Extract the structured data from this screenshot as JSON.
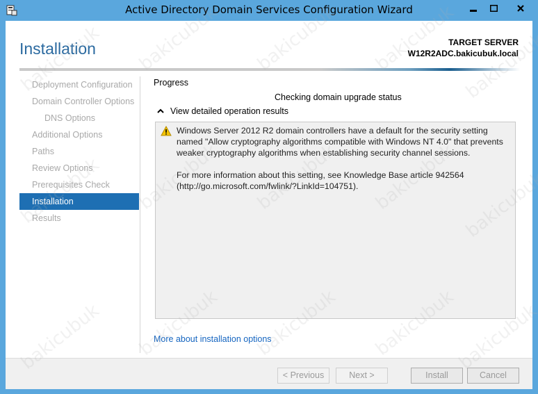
{
  "window": {
    "title": "Active Directory Domain Services Configuration Wizard"
  },
  "header": {
    "page_title": "Installation",
    "target_label": "TARGET SERVER",
    "target_server": "W12R2ADC.bakicubuk.local"
  },
  "nav": {
    "items": [
      {
        "label": "Deployment Configuration"
      },
      {
        "label": "Domain Controller Options"
      },
      {
        "label": "DNS Options"
      },
      {
        "label": "Additional Options"
      },
      {
        "label": "Paths"
      },
      {
        "label": "Review Options"
      },
      {
        "label": "Prerequisites Check"
      },
      {
        "label": "Installation"
      },
      {
        "label": "Results"
      }
    ]
  },
  "main": {
    "progress_label": "Progress",
    "status": "Checking domain upgrade status",
    "expander_label": "View detailed operation results",
    "message_p1": "Windows Server 2012 R2 domain controllers have a default for the security setting named \"Allow cryptography algorithms compatible with Windows NT 4.0\" that prevents weaker cryptography algorithms when establishing security channel sessions.",
    "message_p2": "For more information about this setting, see Knowledge Base article 942564 (http://go.microsoft.com/fwlink/?LinkId=104751).",
    "more_link": "More about installation options"
  },
  "footer": {
    "previous": "< Previous",
    "next": "Next >",
    "install": "Install",
    "cancel": "Cancel"
  },
  "watermark": "bakicubuk",
  "colors": {
    "accent": "#1e6fb3",
    "titlebar": "#5aa7dd",
    "link": "#1565c0"
  }
}
